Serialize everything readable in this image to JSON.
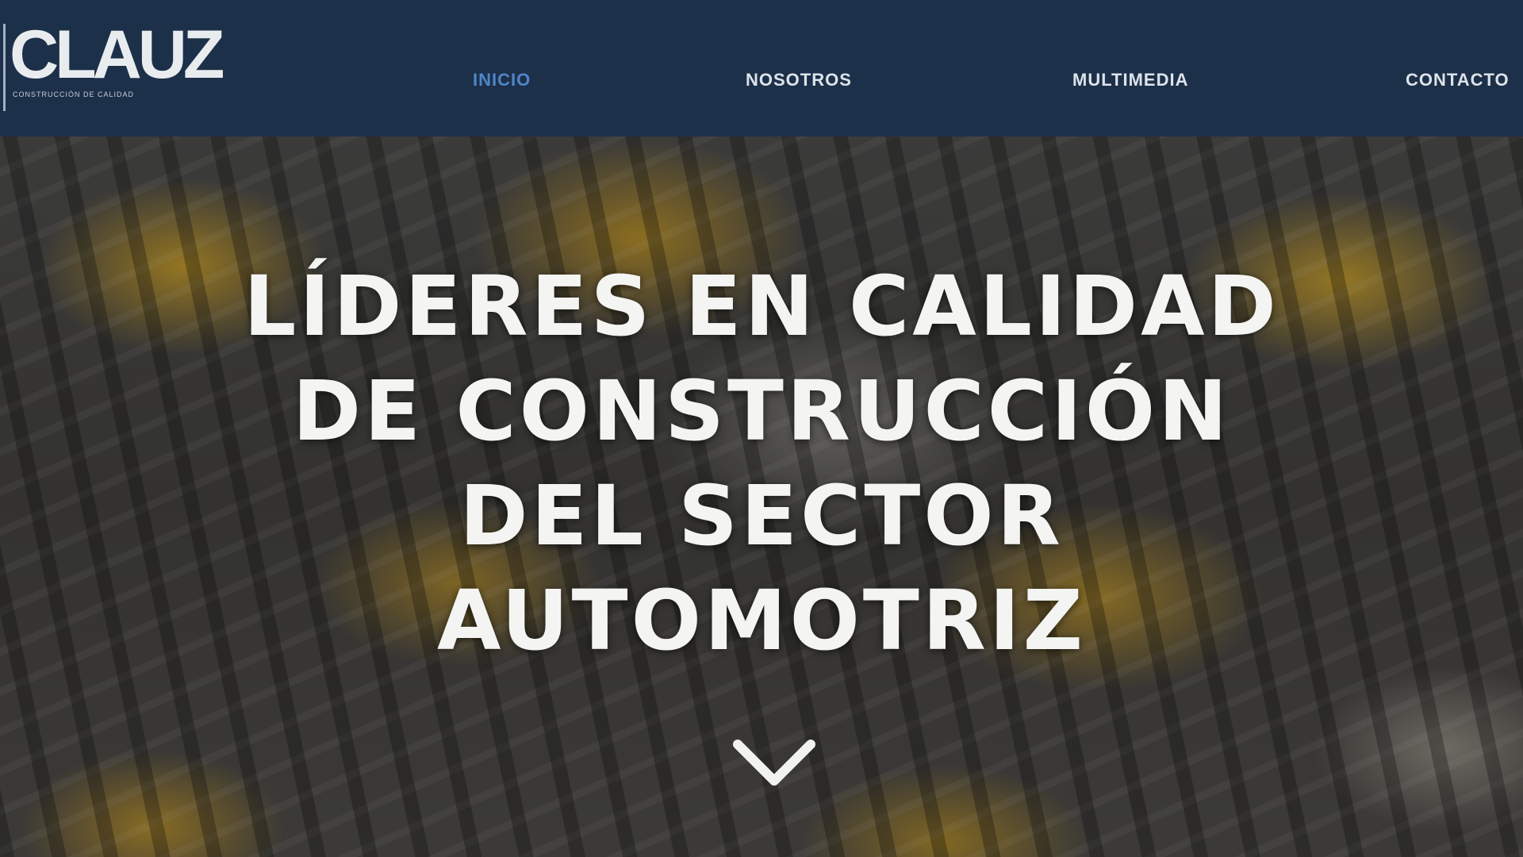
{
  "header": {
    "logo": {
      "text": "CLAUZ",
      "tagline": "CONSTRUCCIÓN DE CALIDAD"
    },
    "nav": [
      {
        "label": "INICIO",
        "active": true
      },
      {
        "label": "NOSOTROS",
        "active": false
      },
      {
        "label": "MULTIMEDIA",
        "active": false
      },
      {
        "label": "CONTACTO",
        "active": false
      }
    ]
  },
  "hero": {
    "title_lines": [
      "LÍDERES EN CALIDAD",
      "DE CONSTRUCCIÓN",
      "DEL SECTOR",
      "AUTOMOTRIZ"
    ],
    "scroll_icon": "chevron-down-icon"
  },
  "colors": {
    "header_bg": "#1d3049",
    "nav_active": "#4f86c9",
    "nav_text": "#dde3ea",
    "hero_text": "#f4f4f2"
  }
}
